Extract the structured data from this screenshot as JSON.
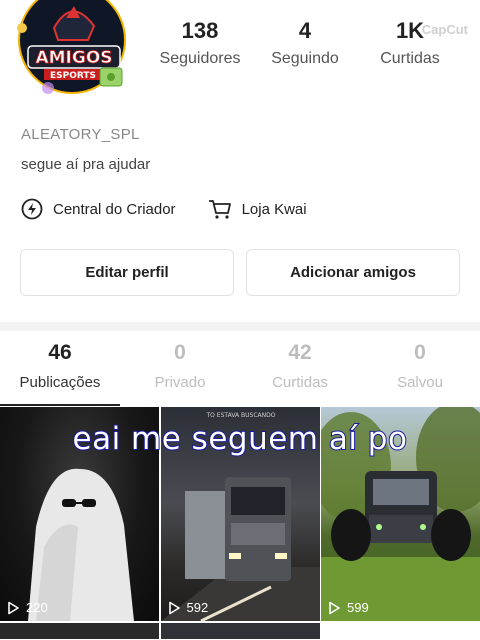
{
  "profile": {
    "avatar_text": "AMIGOS",
    "avatar_subtext": "ESPORTS",
    "username": "ALEATORY_SPL",
    "bio": "segue aí pra ajudar"
  },
  "stats": [
    {
      "value": "138",
      "label": "Seguidores"
    },
    {
      "value": "4",
      "label": "Seguindo"
    },
    {
      "value": "1K",
      "label": "Curtidas"
    }
  ],
  "watermark": "CapCut",
  "links": [
    {
      "label": "Central do Criador",
      "icon": "lightning-icon"
    },
    {
      "label": "Loja Kwai",
      "icon": "cart-icon"
    }
  ],
  "buttons": {
    "edit_profile": "Editar perfil",
    "add_friends": "Adicionar amigos"
  },
  "tabs": [
    {
      "count": "46",
      "label": "Publicações",
      "active": true
    },
    {
      "count": "0",
      "label": "Privado",
      "active": false
    },
    {
      "count": "42",
      "label": "Curtidas",
      "active": false
    },
    {
      "count": "0",
      "label": "Salvou",
      "active": false
    }
  ],
  "videos": [
    {
      "views": "220",
      "thumb": "ghost"
    },
    {
      "views": "592",
      "thumb": "truck",
      "caption": "TO ESTAVA BUSCANDO"
    },
    {
      "views": "599",
      "thumb": "tractor"
    }
  ],
  "overlay_caption": "eai me seguem aí po"
}
